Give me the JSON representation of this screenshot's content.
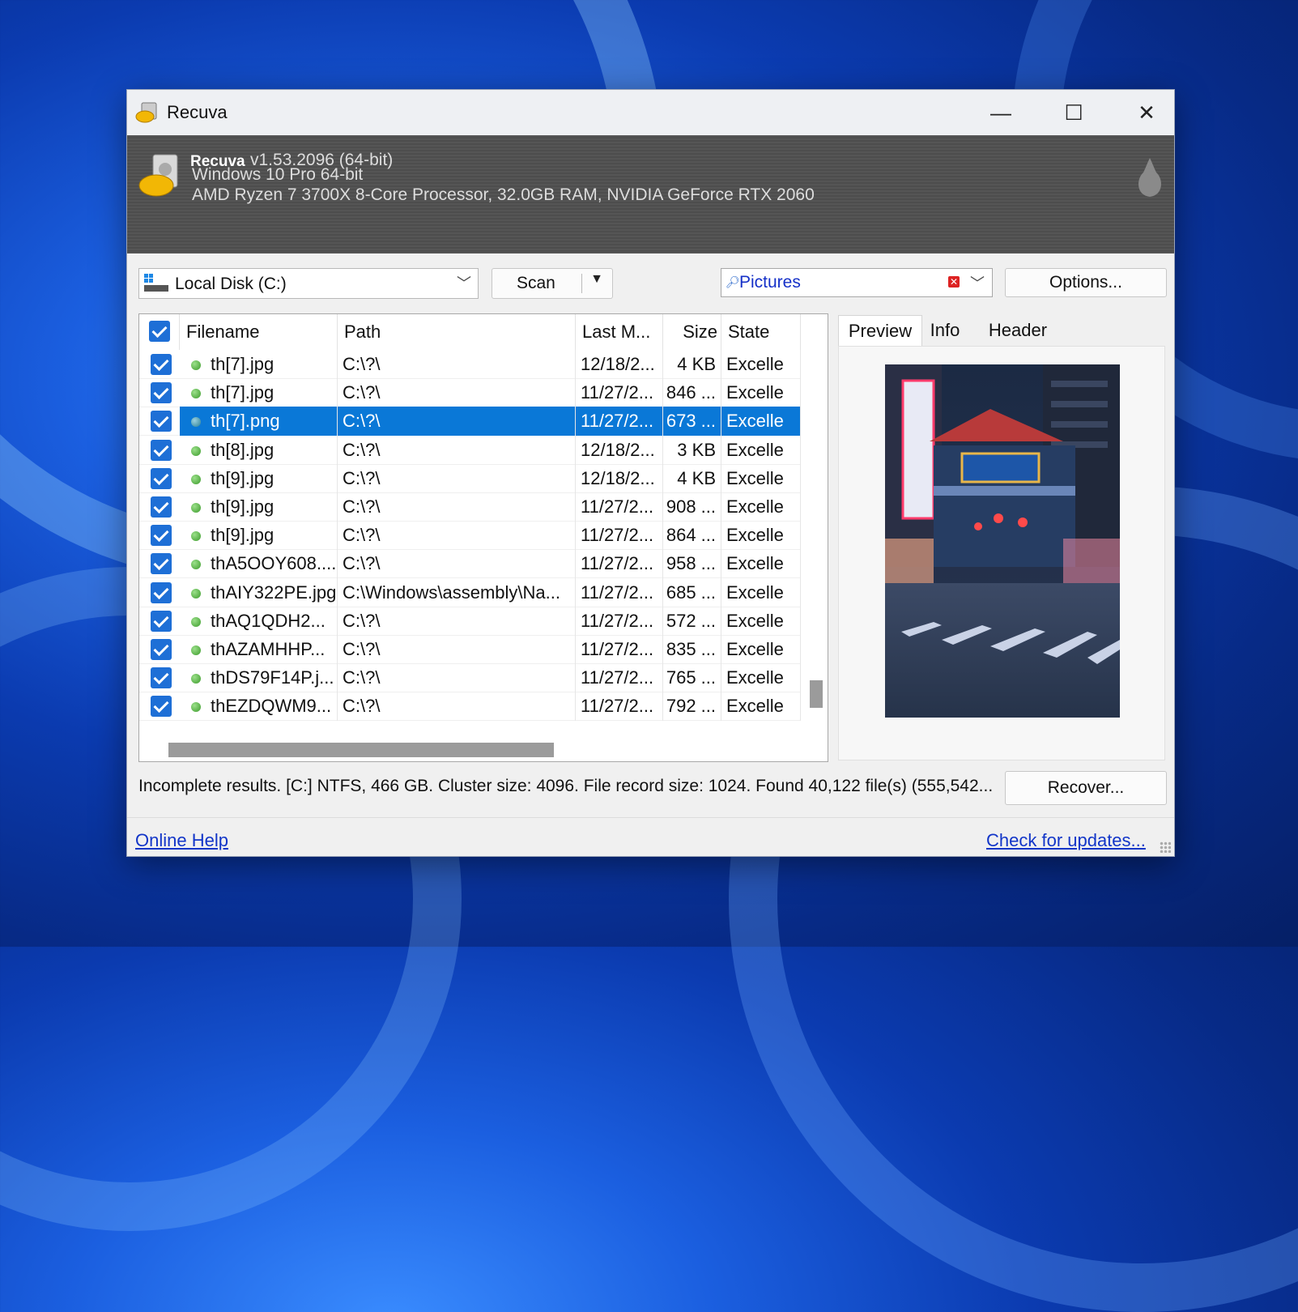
{
  "window": {
    "title": "Recuva",
    "controls": {
      "minimize": "—",
      "maximize": "☐",
      "close": "✕"
    }
  },
  "banner": {
    "app_name": "Recuva",
    "version": "v1.53.2096 (64-bit)",
    "os": "Windows 10 Pro 64-bit",
    "hardware": "AMD Ryzen 7 3700X 8-Core Processor, 32.0GB RAM, NVIDIA GeForce RTX 2060"
  },
  "toolbar": {
    "drive": "Local Disk (C:)",
    "scan_label": "Scan",
    "filter_value": "Pictures",
    "options_label": "Options..."
  },
  "columns": [
    "Filename",
    "Path",
    "Last M...",
    "Size",
    "State"
  ],
  "rows": [
    {
      "filename": "th[7].jpg",
      "path": "C:\\?\\",
      "modified": "12/18/2...",
      "size": "4 KB",
      "state": "Excelle",
      "selected": false
    },
    {
      "filename": "th[7].jpg",
      "path": "C:\\?\\",
      "modified": "11/27/2...",
      "size": "846 ...",
      "state": "Excelle",
      "selected": false
    },
    {
      "filename": "th[7].png",
      "path": "C:\\?\\",
      "modified": "11/27/2...",
      "size": "673 ...",
      "state": "Excelle",
      "selected": true
    },
    {
      "filename": "th[8].jpg",
      "path": "C:\\?\\",
      "modified": "12/18/2...",
      "size": "3 KB",
      "state": "Excelle",
      "selected": false
    },
    {
      "filename": "th[9].jpg",
      "path": "C:\\?\\",
      "modified": "12/18/2...",
      "size": "4 KB",
      "state": "Excelle",
      "selected": false
    },
    {
      "filename": "th[9].jpg",
      "path": "C:\\?\\",
      "modified": "11/27/2...",
      "size": "908 ...",
      "state": "Excelle",
      "selected": false
    },
    {
      "filename": "th[9].jpg",
      "path": "C:\\?\\",
      "modified": "11/27/2...",
      "size": "864 ...",
      "state": "Excelle",
      "selected": false
    },
    {
      "filename": "thA5OOY608....",
      "path": "C:\\?\\",
      "modified": "11/27/2...",
      "size": "958 ...",
      "state": "Excelle",
      "selected": false
    },
    {
      "filename": "thAIY322PE.jpg",
      "path": "C:\\Windows\\assembly\\Na...",
      "modified": "11/27/2...",
      "size": "685 ...",
      "state": "Excelle",
      "selected": false
    },
    {
      "filename": "thAQ1QDH2...",
      "path": "C:\\?\\",
      "modified": "11/27/2...",
      "size": "572 ...",
      "state": "Excelle",
      "selected": false
    },
    {
      "filename": "thAZAMHHP...",
      "path": "C:\\?\\",
      "modified": "11/27/2...",
      "size": "835 ...",
      "state": "Excelle",
      "selected": false
    },
    {
      "filename": "thDS79F14P.j...",
      "path": "C:\\?\\",
      "modified": "11/27/2...",
      "size": "765 ...",
      "state": "Excelle",
      "selected": false
    },
    {
      "filename": "thEZDQWM9...",
      "path": "C:\\?\\",
      "modified": "11/27/2...",
      "size": "792 ...",
      "state": "Excelle",
      "selected": false
    }
  ],
  "tabs": [
    "Preview",
    "Info",
    "Header"
  ],
  "status": "Incomplete results. [C:] NTFS, 466 GB. Cluster size: 4096. File record size: 1024. Found 40,122 file(s) (555,542...",
  "recover_label": "Recover...",
  "footer": {
    "help": "Online Help",
    "updates": "Check for updates..."
  },
  "colors": {
    "selection": "#0a78d7",
    "checkbox": "#1e6fd6",
    "link": "#1235c8",
    "banner": "#4d4d4d"
  },
  "icons": [
    "recuva-hardhat-icon",
    "drive-icon",
    "search-icon",
    "clear-filter-icon",
    "pear-icon",
    "file-status-dot-icon"
  ]
}
